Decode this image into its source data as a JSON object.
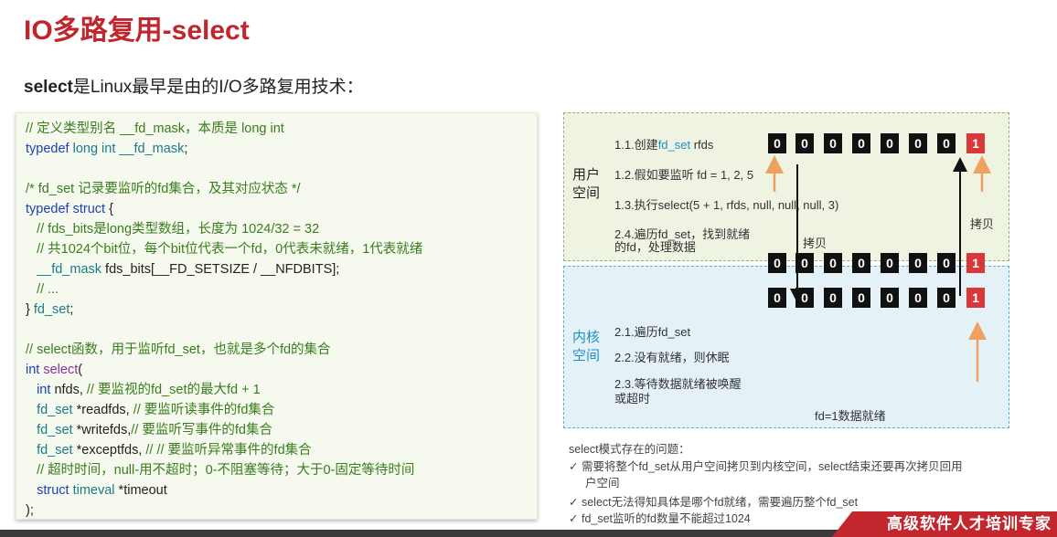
{
  "title": "IO多路复用-select",
  "subtitle_bold": "select",
  "subtitle_rest": "是Linux最早是由的I/O多路复用技术：",
  "code_lines": [
    [
      {
        "c": "cm",
        "t": "// 定义类型别名 __fd_mask，本质是 long int"
      }
    ],
    [
      {
        "c": "kw",
        "t": "typedef "
      },
      {
        "c": "ty",
        "t": "long int "
      },
      {
        "c": "ty",
        "t": "__fd_mask"
      },
      {
        "c": "tx",
        "t": ";"
      }
    ],
    [],
    [
      {
        "c": "cm",
        "t": "/* fd_set 记录要监听的fd集合，及其对应状态 */"
      }
    ],
    [
      {
        "c": "kw",
        "t": "typedef "
      },
      {
        "c": "kw",
        "t": "struct "
      },
      {
        "c": "tx",
        "t": "{"
      }
    ],
    [
      {
        "c": "cm",
        "t": "   // fds_bits是long类型数组，长度为 1024/32 = 32"
      }
    ],
    [
      {
        "c": "cm",
        "t": "   // 共1024个bit位，每个bit位代表一个fd，0代表未就绪，1代表就绪"
      }
    ],
    [
      {
        "c": "ty",
        "t": "   __fd_mask "
      },
      {
        "c": "tx",
        "t": "fds_bits[__FD_SETSIZE / __NFDBITS];"
      }
    ],
    [
      {
        "c": "cm",
        "t": "   // ..."
      }
    ],
    [
      {
        "c": "tx",
        "t": "} "
      },
      {
        "c": "ty",
        "t": "fd_set"
      },
      {
        "c": "tx",
        "t": ";"
      }
    ],
    [],
    [
      {
        "c": "cm",
        "t": "// select函数，用于监听fd_set，也就是多个fd的集合"
      }
    ],
    [
      {
        "c": "kw",
        "t": "int "
      },
      {
        "c": "fn",
        "t": "select"
      },
      {
        "c": "tx",
        "t": "("
      }
    ],
    [
      {
        "c": "kw",
        "t": "   int "
      },
      {
        "c": "tx",
        "t": "nfds, "
      },
      {
        "c": "cm",
        "t": "// 要监视的fd_set的最大fd + 1"
      }
    ],
    [
      {
        "c": "ty",
        "t": "   fd_set "
      },
      {
        "c": "tx",
        "t": "*readfds, "
      },
      {
        "c": "cm",
        "t": "// 要监听读事件的fd集合"
      }
    ],
    [
      {
        "c": "ty",
        "t": "   fd_set "
      },
      {
        "c": "tx",
        "t": "*writefds,"
      },
      {
        "c": "cm",
        "t": "// 要监听写事件的fd集合"
      }
    ],
    [
      {
        "c": "ty",
        "t": "   fd_set "
      },
      {
        "c": "tx",
        "t": "*exceptfds, "
      },
      {
        "c": "cm",
        "t": "// // 要监听异常事件的fd集合"
      }
    ],
    [
      {
        "c": "cm",
        "t": "   // 超时时间，null-用不超时；0-不阻塞等待；大于0-固定等待时间"
      }
    ],
    [
      {
        "c": "kw",
        "t": "   struct "
      },
      {
        "c": "ty",
        "t": "timeval "
      },
      {
        "c": "tx",
        "t": "*timeout"
      }
    ],
    [
      {
        "c": "tx",
        "t": ");"
      }
    ]
  ],
  "user_space": {
    "label_line1": "用户",
    "label_line2": "空间",
    "step1_prefix": "1.1.创建",
    "step1_hl": "fd_set",
    "step1_suffix": " rfds",
    "step2": "1.2.假如要监听 fd = 1, 2, 5",
    "step3": "1.3.执行select(5 + 1, rfds, null, null, null, 3)",
    "step4_line1": "2.4.遍历fd_set，找到就绪",
    "step4_line2": "的fd，处理数据"
  },
  "kernel_space": {
    "label_line1": "内核",
    "label_line2": "空间",
    "step1": "2.1.遍历fd_set",
    "step2": "2.2.没有就绪，则休眠",
    "step3_line1": "2.3.等待数据就绪被唤醒",
    "step3_line2": "或超时",
    "ready_note": "fd=1数据就绪"
  },
  "bit_rows": [
    [
      "0",
      "0",
      "0",
      "0",
      "0",
      "0",
      "0",
      "1"
    ],
    [
      "0",
      "0",
      "0",
      "0",
      "0",
      "0",
      "0",
      "1"
    ],
    [
      "0",
      "0",
      "0",
      "0",
      "0",
      "0",
      "0",
      "1"
    ]
  ],
  "copy_label_down": "拷贝",
  "copy_label_up": "拷贝",
  "problems": {
    "heading": "select模式存在的问题：",
    "item1_line1": "需要将整个fd_set从用户空间拷贝到内核空间，select结束还要再次拷贝回用",
    "item1_line2": "户空间",
    "item2": "select无法得知具体是哪个fd就绪，需要遍历整个fd_set",
    "item3": "fd_set监听的fd数量不能超过1024",
    "check": "✓"
  },
  "brand": "高级软件人才培训专家",
  "colors": {
    "title": "#c0262d",
    "bit_one": "#d9383a",
    "arrow": "#f0a060",
    "kernel_label": "#1e8fc4"
  }
}
